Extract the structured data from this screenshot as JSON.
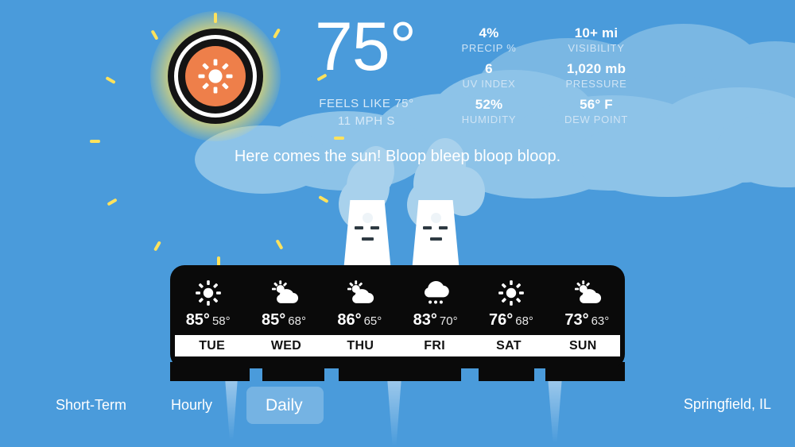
{
  "app": {
    "background_color": "#4a9bdb",
    "accent_color": "#ee7f4a",
    "panel_color": "#0a0a0a"
  },
  "current": {
    "temperature": "75°",
    "feels_like": "FEELS LIKE 75°",
    "wind": "11 MPH S",
    "condition_icon": "sun-icon",
    "message": "Here comes the sun! Bloop bleep bloop bloop."
  },
  "stats_left": [
    {
      "value": "4%",
      "label": "PRECIP %"
    },
    {
      "value": "6",
      "label": "UV INDEX"
    },
    {
      "value": "52%",
      "label": "HUMIDITY"
    }
  ],
  "stats_right": [
    {
      "value": "10+ mi",
      "label": "VISIBILITY"
    },
    {
      "value": "1,020 mb",
      "label": "PRESSURE"
    },
    {
      "value": "56° F",
      "label": "DEW POINT"
    }
  ],
  "forecast": {
    "days": [
      {
        "name": "TUE",
        "icon": "sun-icon",
        "high": "85°",
        "low": "58°"
      },
      {
        "name": "WED",
        "icon": "sun-cloud-icon",
        "high": "85°",
        "low": "68°"
      },
      {
        "name": "THU",
        "icon": "sun-cloud-icon",
        "high": "86°",
        "low": "65°"
      },
      {
        "name": "FRI",
        "icon": "rain-cloud-icon",
        "high": "83°",
        "low": "70°"
      },
      {
        "name": "SAT",
        "icon": "sun-icon",
        "high": "76°",
        "low": "68°"
      },
      {
        "name": "SUN",
        "icon": "sun-cloud-icon",
        "high": "73°",
        "low": "63°"
      }
    ]
  },
  "nav": {
    "items": [
      {
        "label": "Short-Term",
        "active": false
      },
      {
        "label": "Hourly",
        "active": false
      },
      {
        "label": "Daily",
        "active": true
      }
    ],
    "location": "Springfield, IL"
  }
}
